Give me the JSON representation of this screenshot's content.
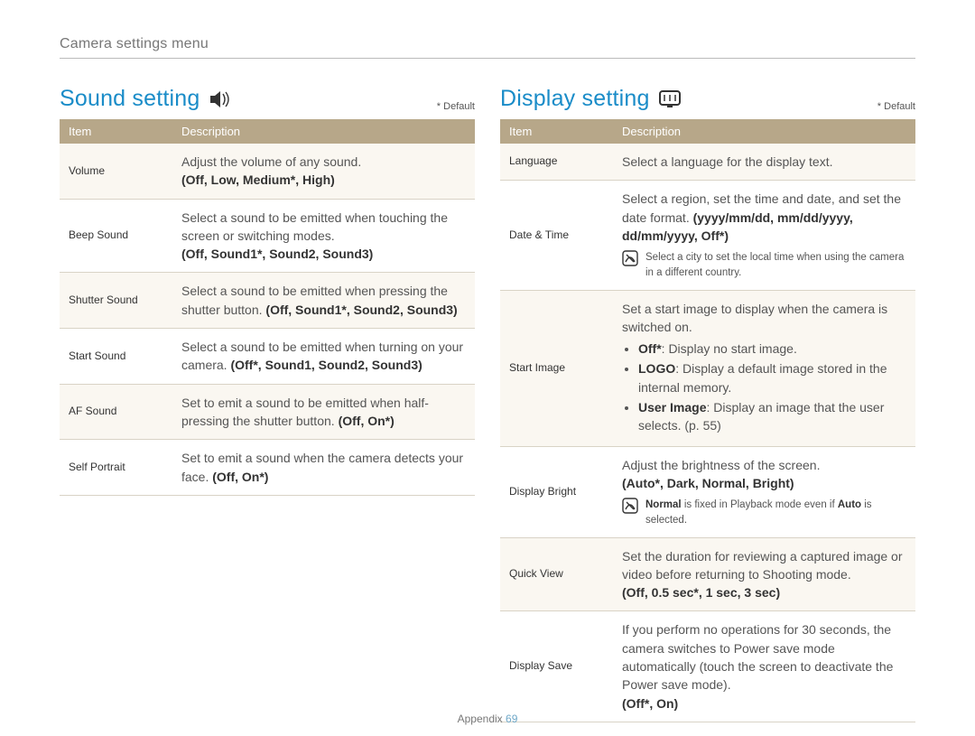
{
  "breadcrumb": "Camera settings menu",
  "default_label": "* Default",
  "header_item": "Item",
  "header_desc": "Description",
  "footer_section": "Appendix",
  "footer_page": "69",
  "sound": {
    "title": "Sound setting",
    "rows": {
      "volume": {
        "item": "Volume",
        "desc": "Adjust the volume of any sound.",
        "opts": "(Off, Low, Medium*, High)"
      },
      "beep": {
        "item": "Beep Sound",
        "desc": "Select a sound to be emitted when touching the screen or switching modes.",
        "opts": "(Off, Sound1*, Sound2, Sound3)"
      },
      "shutter": {
        "item": "Shutter Sound",
        "desc_pre": "Select a sound to be emitted when pressing the shutter button. ",
        "opts": "(Off, Sound1*, Sound2, Sound3)"
      },
      "start": {
        "item": "Start Sound",
        "desc_pre": "Select a sound to be emitted when turning on your camera. ",
        "opts": "(Off*, Sound1, Sound2, Sound3)"
      },
      "af": {
        "item": "AF Sound",
        "desc_pre": "Set to emit a sound to be emitted when half-pressing the shutter button. ",
        "opts": "(Off, On*)"
      },
      "self": {
        "item": "Self Portrait",
        "desc_pre": "Set to emit a sound when the camera detects your face. ",
        "opts": "(Off, On*)"
      }
    }
  },
  "display": {
    "title": "Display setting",
    "rows": {
      "language": {
        "item": "Language",
        "desc": "Select a language for the display text."
      },
      "datetime": {
        "item": "Date & Time",
        "desc_pre": "Select a region, set the time and date, and set the date format. ",
        "opts": "(yyyy/mm/dd, mm/dd/yyyy, dd/mm/yyyy, Off*)",
        "note": "Select a city to set the local time when using the camera in a different country."
      },
      "startimg": {
        "item": "Start Image",
        "intro": "Set a start image to display when the camera is switched on.",
        "li_off_b": "Off*",
        "li_off_t": ": Display no start image.",
        "li_logo_b": "LOGO",
        "li_logo_t": ": Display a default image stored in the internal memory.",
        "li_user_b": "User Image",
        "li_user_t": ": Display an image that the user selects. (p. 55)"
      },
      "bright": {
        "item": "Display Bright",
        "desc": "Adjust the brightness of the screen.",
        "opts": "(Auto*, Dark, Normal, Bright)",
        "note_b1": "Normal",
        "note_mid": " is fixed in Playback mode even if ",
        "note_b2": "Auto",
        "note_end": " is selected."
      },
      "quick": {
        "item": "Quick View",
        "desc": "Set the duration for reviewing a captured image or video before returning to Shooting mode.",
        "opts": "(Off, 0.5 sec*, 1 sec, 3 sec)"
      },
      "save": {
        "item": "Display Save",
        "desc": "If you perform no operations for 30 seconds, the camera switches to Power save mode automatically (touch the screen to deactivate the Power save mode).",
        "opts": "(Off*, On)"
      }
    }
  }
}
